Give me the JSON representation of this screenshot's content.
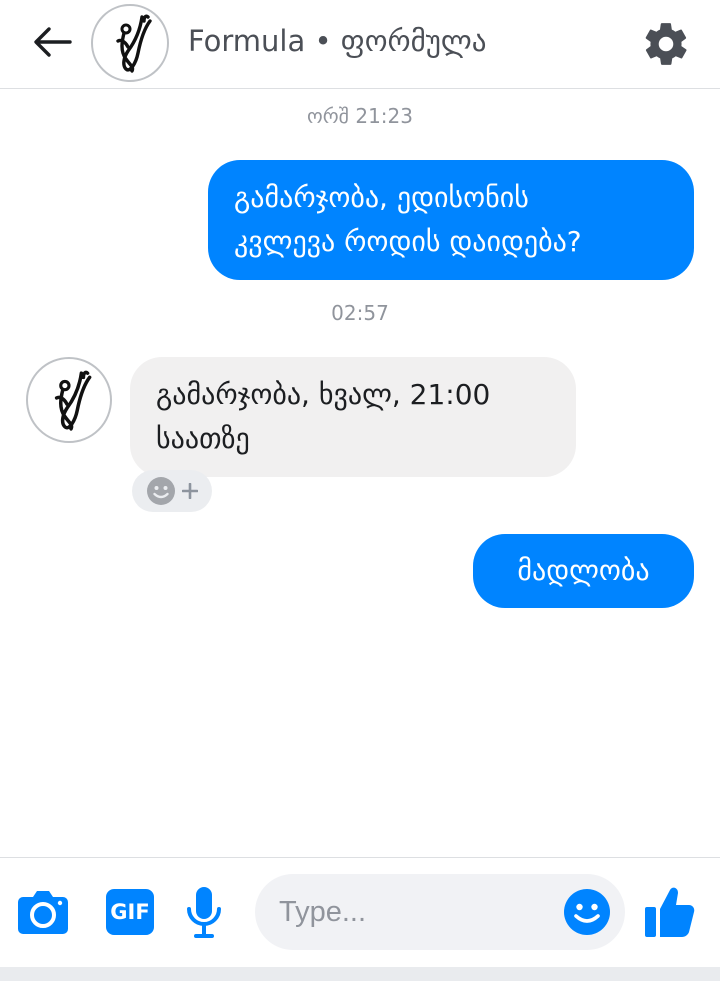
{
  "header": {
    "title": "Formula • ფორმულა"
  },
  "messages": {
    "timestamp_1": "ორშ 21:23",
    "outgoing_1": [
      "გამარჯობა, ედისონის",
      "კვლევა როდის დაიდება?"
    ],
    "timestamp_2": "02:57",
    "incoming_1": [
      "გამარჯობა, ხვალ, 21:00",
      "საათზე"
    ],
    "outgoing_2": "მადლობა"
  },
  "composer": {
    "placeholder": "Type...",
    "gif_label": "GIF"
  },
  "colors": {
    "accent": "#0084ff",
    "incoming_bubble": "#f1f0f0"
  }
}
